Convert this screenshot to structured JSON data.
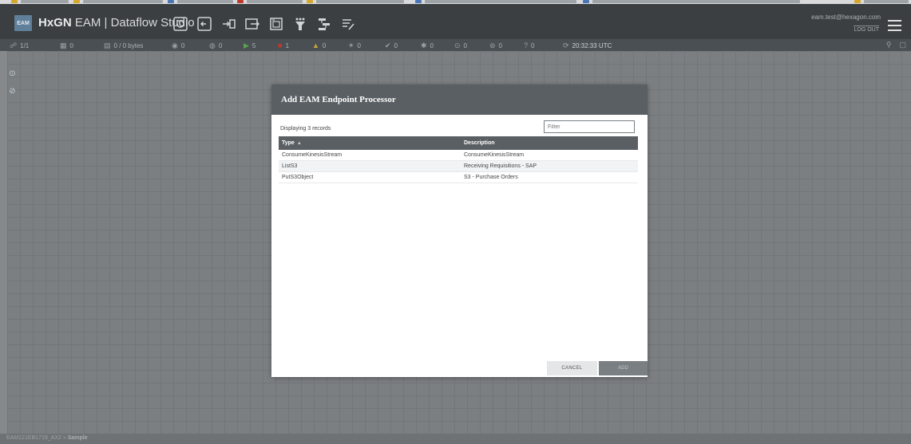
{
  "header": {
    "logo_badge": "EAM",
    "brand": "HxGN",
    "title_rest": " EAM | Dataflow Studio",
    "user_email": "eam.test@hexagon.com",
    "logout_label": "LOG OUT",
    "toolbar_icons": [
      "refresh-icon",
      "input-port-icon",
      "output-port-icon",
      "remote-process-group-icon",
      "processor-group-icon",
      "funnel-icon",
      "template-icon",
      "label-icon"
    ]
  },
  "status_bar": {
    "cluster": "1/1",
    "threads": "0",
    "queued": "0 / 0 bytes",
    "transmitting": "0",
    "not_transmitting": "0",
    "running": "5",
    "stopped": "1",
    "invalid": "0",
    "disabled": "0",
    "up_to_date": "0",
    "locally_modified": "0",
    "stale": "0",
    "modified_stale": "0",
    "sync_failure": "0",
    "last_refreshed": "20:32:33 UTC"
  },
  "footer": {
    "breadcrumb_root": "EAM121EB1719_AX2",
    "breadcrumb_sep": "»",
    "breadcrumb_current": "Sample"
  },
  "dialog": {
    "title": "Add EAM Endpoint Processor",
    "count_label": "Displaying 3 records",
    "filter_placeholder": "Filter",
    "columns": {
      "type": "Type",
      "description": "Description"
    },
    "sort_indicator": "▲",
    "rows": [
      {
        "type": "ConsumeKinesisStream",
        "description": "ConsumeKinesisStream"
      },
      {
        "type": "ListS3",
        "description": "Receiving Requisitions - SAP"
      },
      {
        "type": "PutS3Object",
        "description": "S3 - Purchase Orders"
      }
    ],
    "cancel_label": "CANCEL",
    "add_label": "ADD"
  },
  "colors": {
    "header_bg": "#3b3f41",
    "dialog_header_bg": "#5a5f63",
    "running_green": "#5aa34c",
    "stopped_red": "#c0392b"
  }
}
